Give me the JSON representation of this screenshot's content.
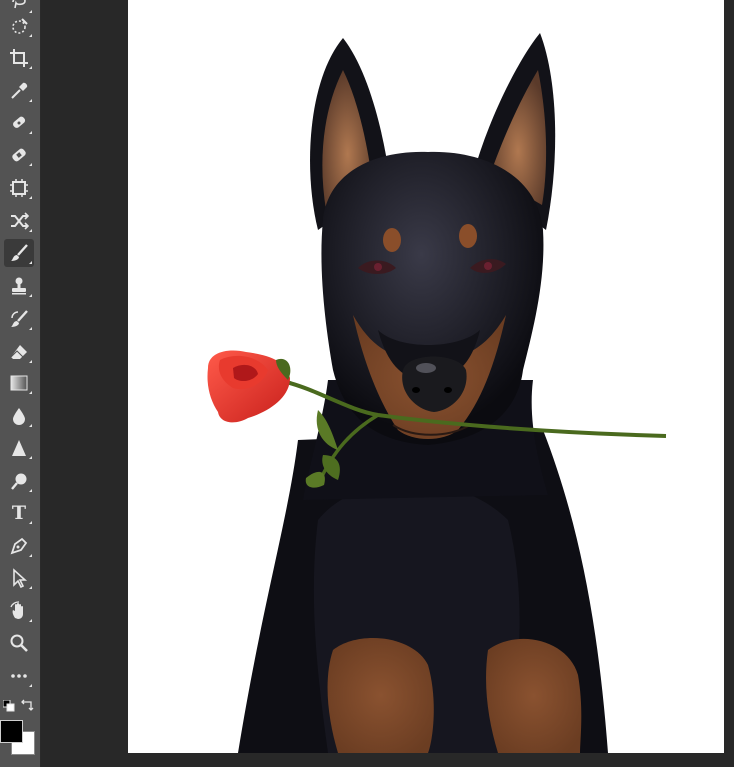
{
  "toolbar": {
    "tools": [
      {
        "name": "lasso-tool",
        "icon": "lasso-icon"
      },
      {
        "name": "quick-selection-tool",
        "icon": "quick-selection-icon"
      },
      {
        "name": "crop-tool",
        "icon": "crop-icon"
      },
      {
        "name": "eyedropper-tool",
        "icon": "eyedropper-icon"
      },
      {
        "name": "spot-healing-tool",
        "icon": "spot-healing-icon"
      },
      {
        "name": "healing-brush-tool",
        "icon": "bandage-icon"
      },
      {
        "name": "content-aware-tool",
        "icon": "content-aware-icon"
      },
      {
        "name": "content-aware-move-tool",
        "icon": "shuffle-icon"
      },
      {
        "name": "brush-tool",
        "icon": "brush-icon",
        "active": true
      },
      {
        "name": "clone-stamp-tool",
        "icon": "stamp-icon"
      },
      {
        "name": "history-brush-tool",
        "icon": "history-brush-icon"
      },
      {
        "name": "eraser-tool",
        "icon": "eraser-icon"
      },
      {
        "name": "gradient-tool",
        "icon": "gradient-icon"
      },
      {
        "name": "blur-tool",
        "icon": "drop-icon"
      },
      {
        "name": "sharpen-tool",
        "icon": "triangle-icon"
      },
      {
        "name": "dodge-tool",
        "icon": "dodge-icon"
      },
      {
        "name": "type-tool",
        "icon": "type-icon",
        "label": "T"
      },
      {
        "name": "pen-tool",
        "icon": "pen-icon"
      },
      {
        "name": "path-selection-tool",
        "icon": "arrow-icon"
      },
      {
        "name": "rotate-view-tool",
        "icon": "hand-icon"
      },
      {
        "name": "zoom-tool",
        "icon": "magnifier-icon"
      },
      {
        "name": "edit-toolbar",
        "icon": "ellipsis-icon"
      }
    ],
    "foreground_color": "#000000",
    "background_color": "#ffffff"
  },
  "canvas": {
    "background": "#ffffff",
    "artwork": "doberman-with-rose-illustration"
  },
  "colors": {
    "toolbar_bg": "#535353",
    "pasteboard_bg": "#282828",
    "icon_color": "#e6e6e6",
    "active_tool_bg": "#3a3a3a"
  }
}
